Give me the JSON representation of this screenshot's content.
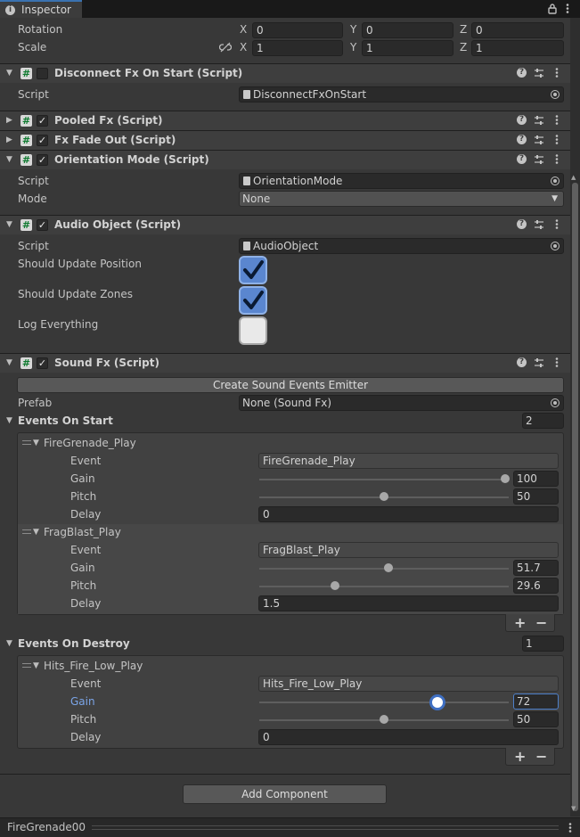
{
  "window": {
    "tab_label": "Inspector",
    "tab_icon": "info-icon",
    "lock_icon": "lock-icon",
    "menu_icon": "kebab-menu-icon"
  },
  "transform": {
    "rotation_label": "Rotation",
    "scale_label": "Scale",
    "axis_x": "X",
    "axis_y": "Y",
    "axis_z": "Z",
    "rotation": [
      "0",
      "0",
      "0"
    ],
    "scale": [
      "1",
      "1",
      "1"
    ],
    "constrain_icon": "link-icon"
  },
  "disconnect": {
    "title": "Disconnect Fx On Start (Script)",
    "enabled": false,
    "script_label": "Script",
    "script_value": "DisconnectFxOnStart"
  },
  "pooled": {
    "title": "Pooled Fx (Script)",
    "enabled": true
  },
  "fade": {
    "title": "Fx Fade Out (Script)",
    "enabled": true
  },
  "orientation": {
    "title": "Orientation Mode (Script)",
    "enabled": true,
    "script_label": "Script",
    "script_value": "OrientationMode",
    "mode_label": "Mode",
    "mode_value": "None"
  },
  "audio": {
    "title": "Audio Object (Script)",
    "enabled": true,
    "script_label": "Script",
    "script_value": "AudioObject",
    "update_position_label": "Should Update Position",
    "update_position": true,
    "update_zones_label": "Should Update Zones",
    "update_zones": true,
    "log_label": "Log Everything",
    "log": false
  },
  "sound": {
    "title": "Sound Fx (Script)",
    "enabled": true,
    "create_button": "Create Sound Events Emitter",
    "prefab_label": "Prefab",
    "prefab_value": "None (Sound Fx)",
    "on_start": {
      "label": "Events On Start",
      "count": "2",
      "items": [
        {
          "name": "FireGrenade_Play",
          "event_label": "Event",
          "event": "FireGrenade_Play",
          "gain_label": "Gain",
          "gain": "100",
          "gain_fraction": 1.0,
          "pitch_label": "Pitch",
          "pitch": "50",
          "pitch_fraction": 0.5,
          "delay_label": "Delay",
          "delay": "0"
        },
        {
          "name": "FragBlast_Play",
          "event_label": "Event",
          "event": "FragBlast_Play",
          "gain_label": "Gain",
          "gain": "51.7",
          "gain_fraction": 0.517,
          "pitch_label": "Pitch",
          "pitch": "29.6",
          "pitch_fraction": 0.296,
          "delay_label": "Delay",
          "delay": "1.5"
        }
      ]
    },
    "on_destroy": {
      "label": "Events On Destroy",
      "count": "1",
      "items": [
        {
          "name": "Hits_Fire_Low_Play",
          "event_label": "Event",
          "event": "Hits_Fire_Low_Play",
          "gain_label": "Gain",
          "gain": "72",
          "gain_fraction": 0.72,
          "pitch_label": "Pitch",
          "pitch": "50",
          "pitch_fraction": 0.5,
          "delay_label": "Delay",
          "delay": "0"
        }
      ]
    },
    "plus": "+",
    "minus": "−"
  },
  "add_component": "Add Component",
  "status": {
    "object_name": "FireGrenade00"
  },
  "colors": {
    "accent": "#3f6fc2",
    "checkbox_on": "#5a86cf",
    "hash_icon_green": "#0e7a2f"
  }
}
